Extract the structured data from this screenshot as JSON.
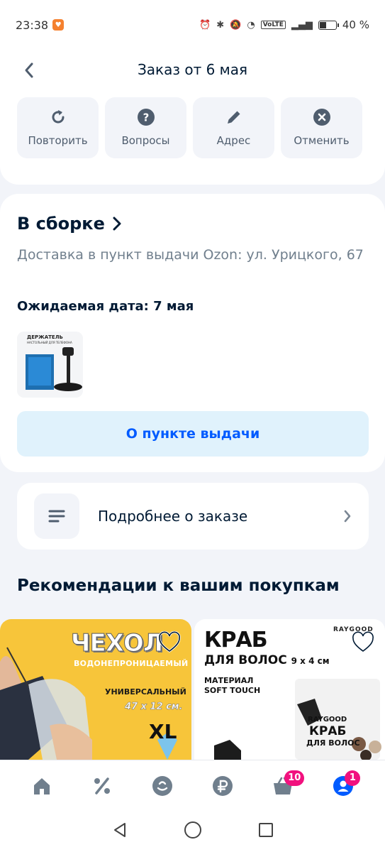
{
  "status_bar": {
    "time": "23:38",
    "battery": "40 %",
    "battery_level": 0.4,
    "network": "VoLTE"
  },
  "header": {
    "title": "Заказ от 6 мая"
  },
  "actions": [
    {
      "label": "Повторить",
      "icon": "refresh-icon"
    },
    {
      "label": "Вопросы",
      "icon": "question-icon"
    },
    {
      "label": "Адрес",
      "icon": "pencil-icon"
    },
    {
      "label": "Отменить",
      "icon": "cancel-icon"
    }
  ],
  "order": {
    "status": "В сборке",
    "delivery": "Доставка в пункт выдачи Ozon: ул. Урицкого, 67",
    "expected_date": "Ожидаемая дата: 7 мая",
    "pickup_button": "О пункте выдачи",
    "thumb_caption": "ДЕРЖАТЕЛЬ",
    "thumb_caption_sub": "НАСТОЛЬНЫЙ ДЛЯ ТЕЛЕФОНА"
  },
  "details": {
    "label": "Подробнее о заказе"
  },
  "recommendations": {
    "title": "Рекомендации к вашим покупкам",
    "products": [
      {
        "title": "ЧЕХОЛ",
        "subtitle": "ВОДОНЕПРОНИЦАЕМЫЙ",
        "universal": "УНИВЕРСАЛЬНЫЙ",
        "size": "47 х 12 см.",
        "badge": "XL"
      },
      {
        "title": "КРАБ",
        "subtitle": "ДЛЯ ВОЛОС",
        "size": "9 x 4 см",
        "material": "МАТЕРИАЛ",
        "material_value": "SOFT TOUCH",
        "brand": "RAYGOOD",
        "box_brand": "RAYGOOD",
        "box_title": "КРАБ",
        "box_subtitle": "ДЛЯ ВОЛОС"
      }
    ]
  },
  "bottom_nav": {
    "cart_badge": "10",
    "profile_badge": "1"
  },
  "colors": {
    "accent": "#005bff",
    "badge": "#f1117e",
    "page_bg": "#f2f4f9"
  }
}
